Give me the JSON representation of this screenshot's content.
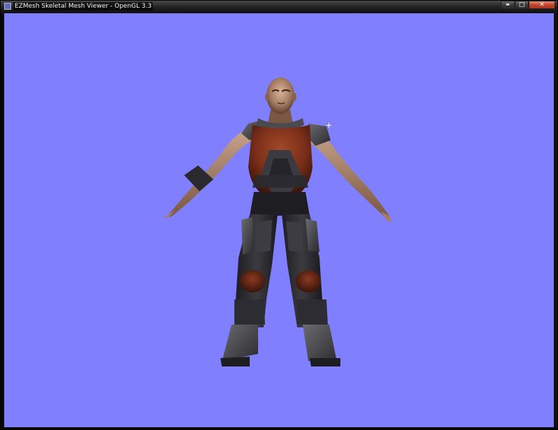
{
  "window": {
    "title": "EZMesh Skeletal Mesh Viewer - OpenGL 3.3",
    "icon": "app-icon"
  },
  "caption": {
    "minimize_glyph": "▬",
    "maximize_glyph": "□",
    "close_glyph": "✕"
  },
  "viewport": {
    "background_color": "#8080ff",
    "cursor": "crosshair-cursor",
    "model": "armored-soldier-t-pose"
  }
}
